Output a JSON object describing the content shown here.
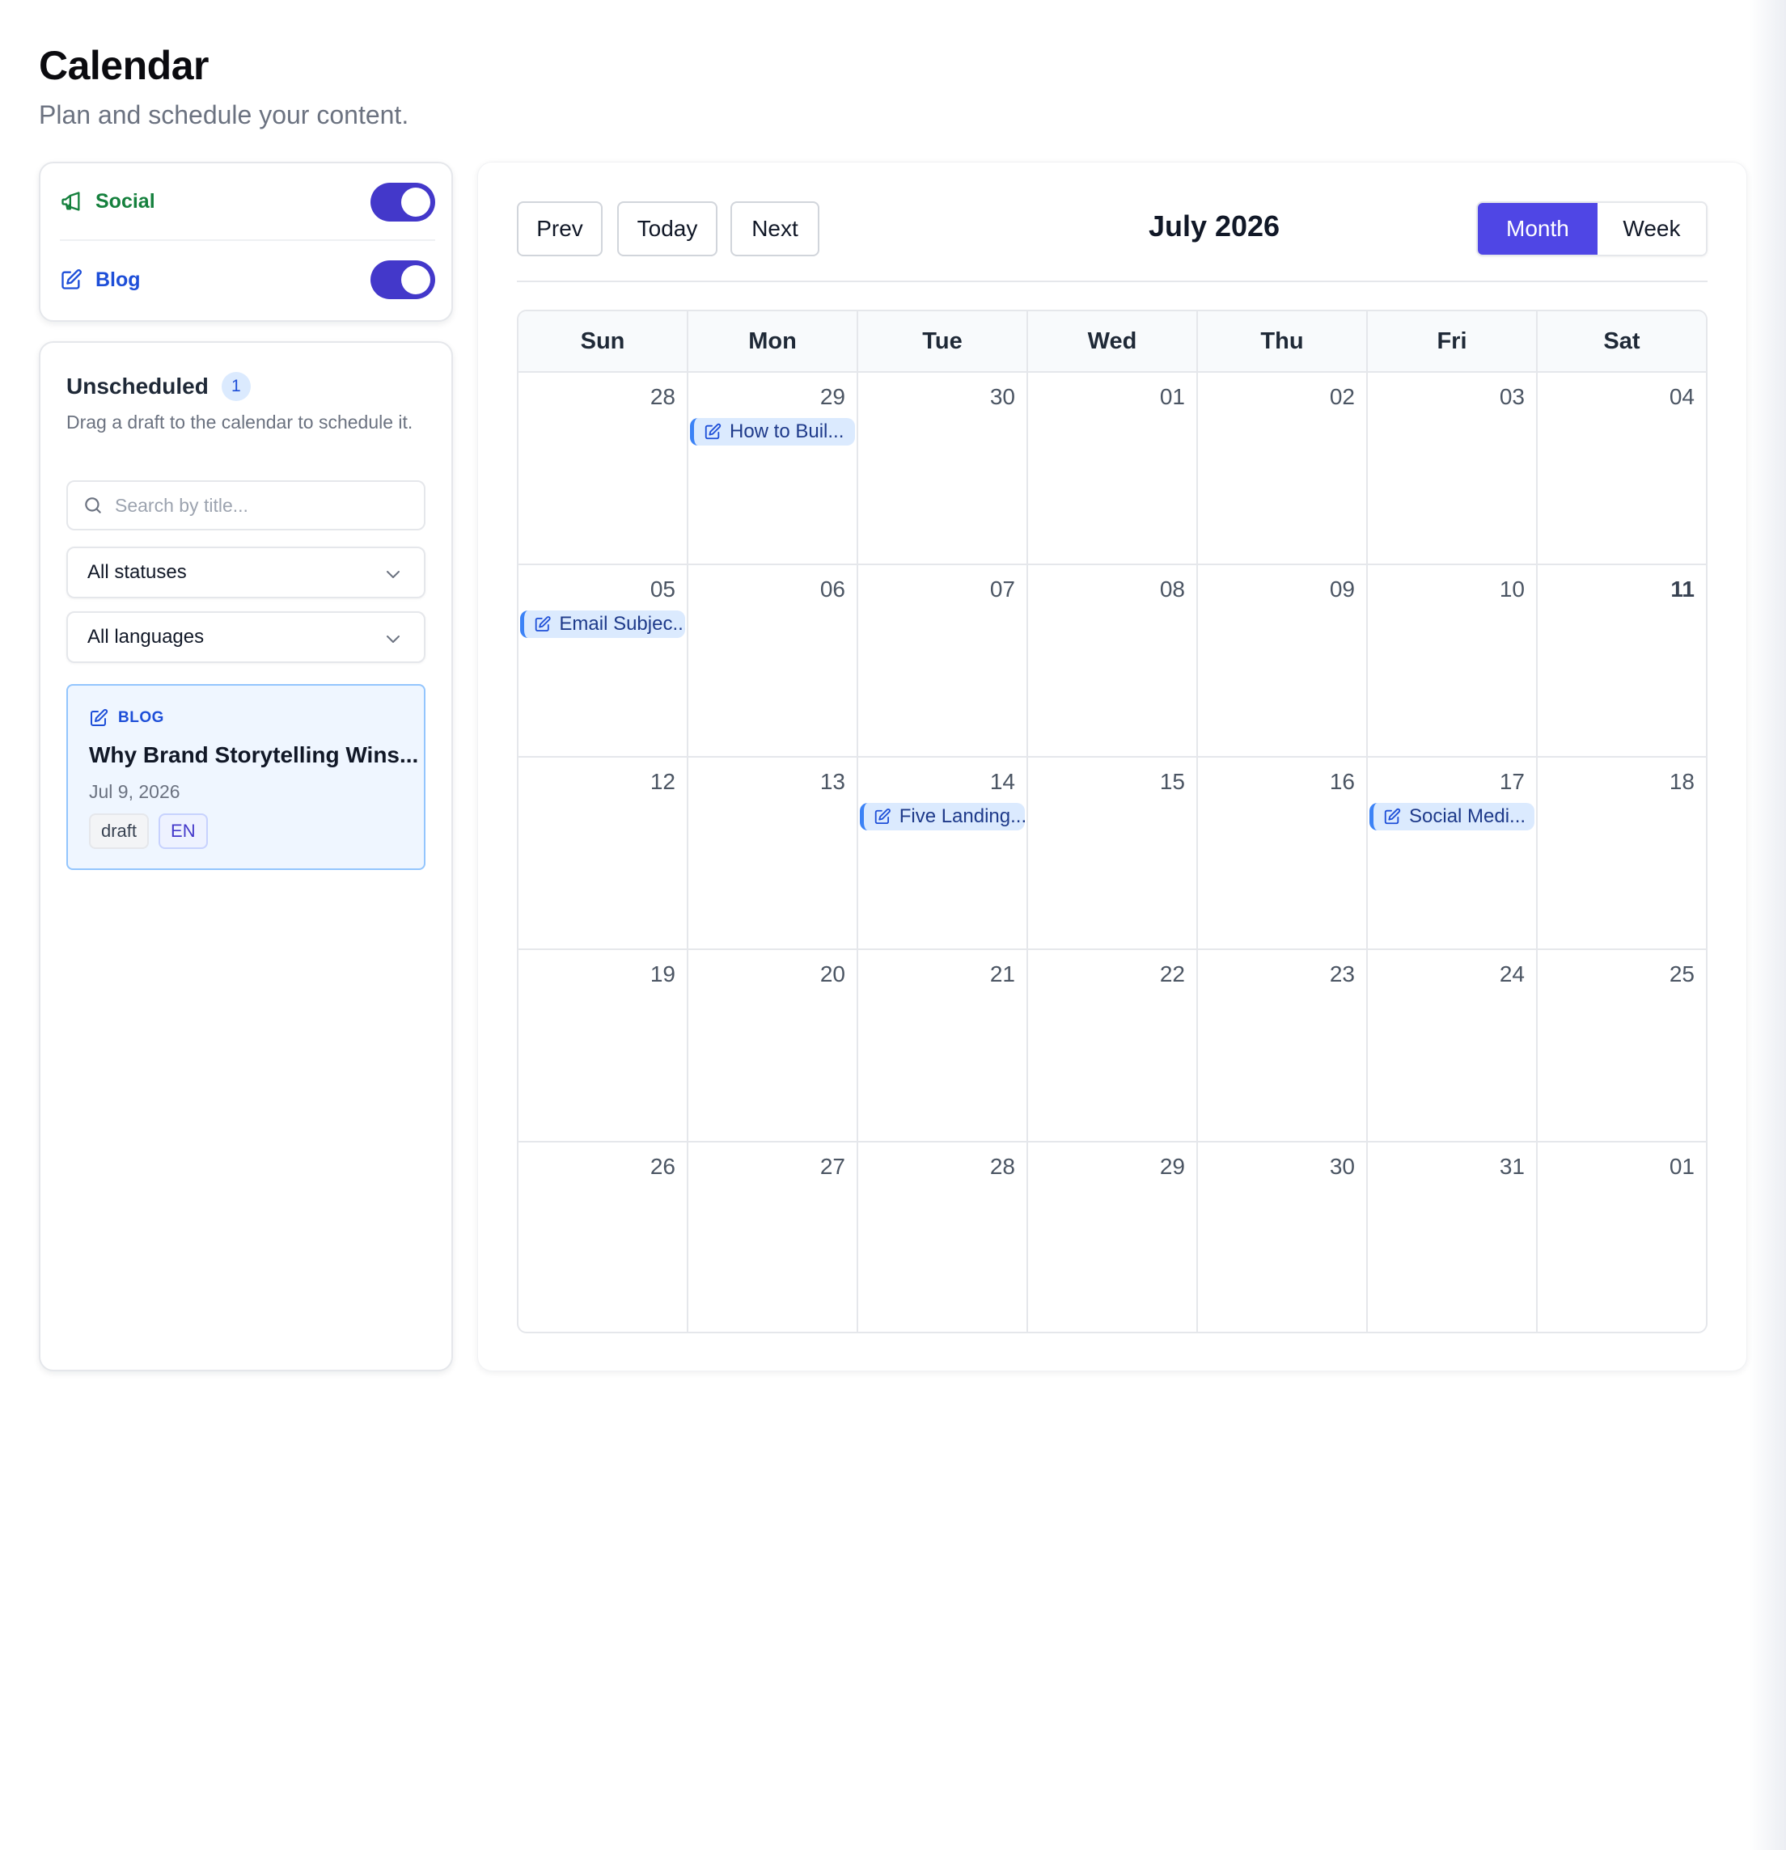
{
  "header": {
    "title": "Calendar",
    "subtitle": "Plan and schedule your content."
  },
  "filters": [
    {
      "label": "Social",
      "icon": "megaphone-icon",
      "color": "#15803d",
      "enabled": true
    },
    {
      "label": "Blog",
      "icon": "edit-icon",
      "color": "#1d4ed8",
      "enabled": true
    }
  ],
  "unscheduled": {
    "title": "Unscheduled",
    "count": "1",
    "help": "Drag a draft to the calendar to schedule it.",
    "search_placeholder": "Search by title...",
    "status_select": "All statuses",
    "language_select": "All languages",
    "drafts": [
      {
        "type": "BLOG",
        "title": "Why Brand Storytelling Wins...",
        "date": "Jul 9, 2026",
        "status": "draft",
        "language": "EN"
      }
    ]
  },
  "calendar": {
    "nav": {
      "prev": "Prev",
      "today": "Today",
      "next": "Next"
    },
    "month_label": "July 2026",
    "views": {
      "month": "Month",
      "week": "Week",
      "active": "Month"
    },
    "weekdays": [
      "Sun",
      "Mon",
      "Tue",
      "Wed",
      "Thu",
      "Fri",
      "Sat"
    ],
    "today": "11",
    "weeks": [
      [
        "28",
        "29",
        "30",
        "01",
        "02",
        "03",
        "04"
      ],
      [
        "05",
        "06",
        "07",
        "08",
        "09",
        "10",
        "11"
      ],
      [
        "12",
        "13",
        "14",
        "15",
        "16",
        "17",
        "18"
      ],
      [
        "19",
        "20",
        "21",
        "22",
        "23",
        "24",
        "25"
      ],
      [
        "26",
        "27",
        "28",
        "29",
        "30",
        "31",
        "01"
      ]
    ],
    "events": [
      {
        "week": 0,
        "day": 1,
        "title": "How to Buil...",
        "icon": "edit-icon"
      },
      {
        "week": 1,
        "day": 0,
        "title": "Email Subjec...",
        "icon": "edit-icon"
      },
      {
        "week": 2,
        "day": 2,
        "title": "Five Landing...",
        "icon": "edit-icon"
      },
      {
        "week": 2,
        "day": 5,
        "title": "Social Medi...",
        "icon": "edit-icon"
      }
    ]
  },
  "colors": {
    "accent": "#4f46e5",
    "toggle": "#4338ca",
    "event_bg": "#dbeafe",
    "event_border": "#3b82f6"
  }
}
